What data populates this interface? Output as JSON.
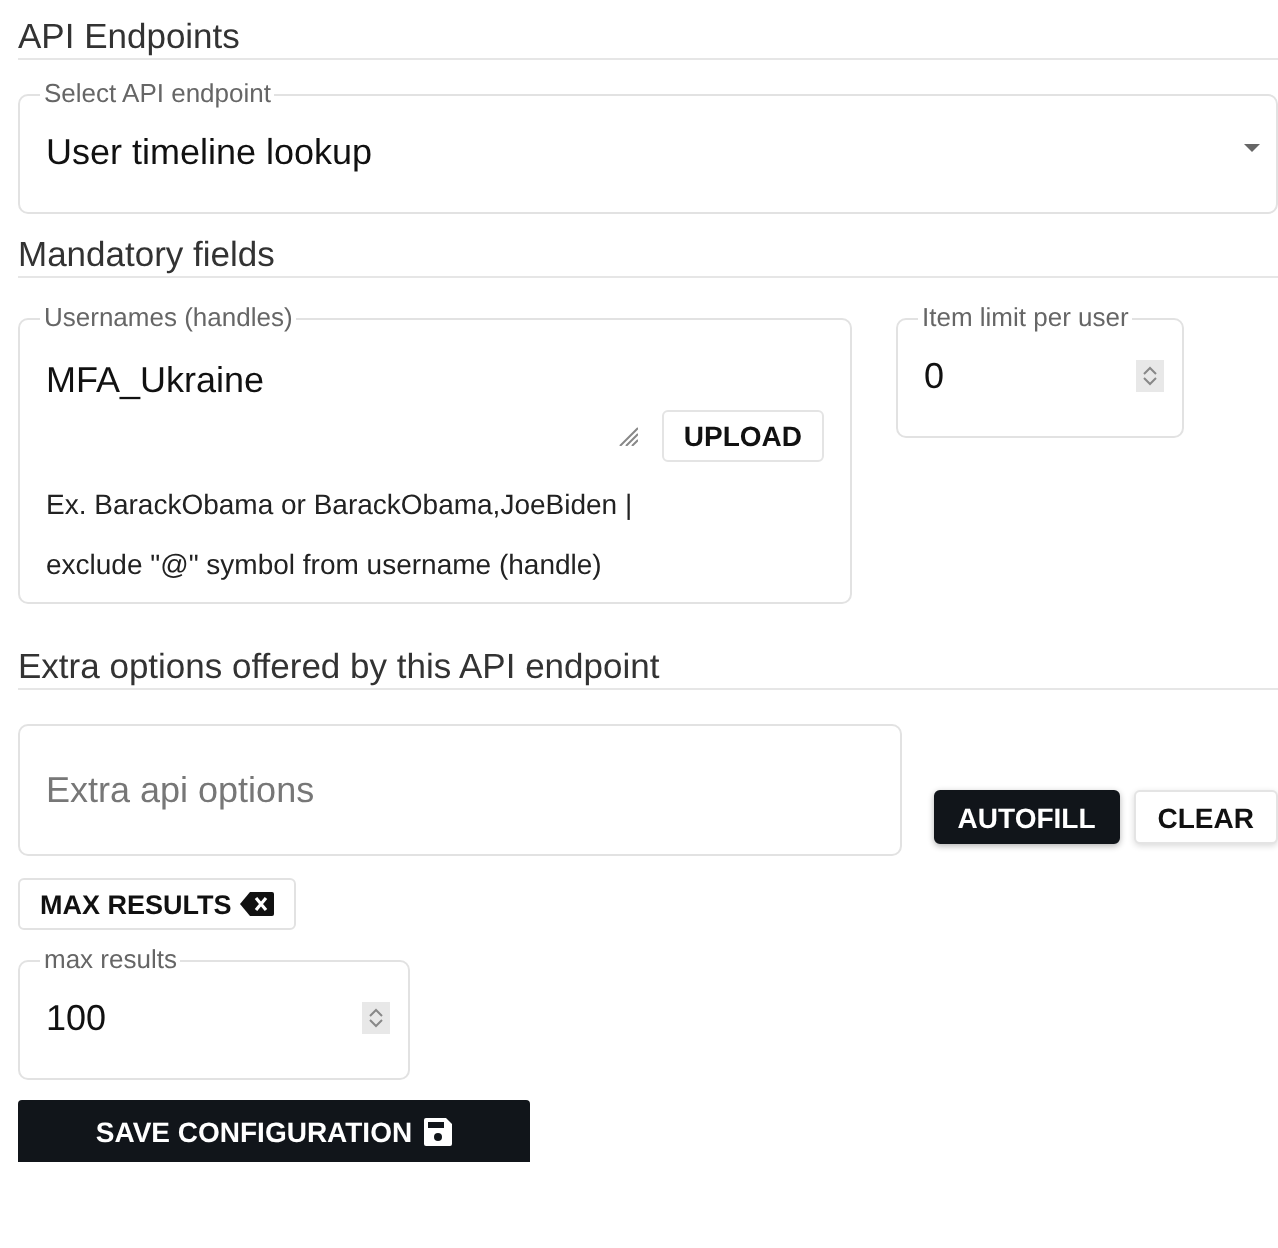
{
  "endpoint_section": {
    "title": "API Endpoints",
    "select": {
      "label": "Select API endpoint",
      "value": "User timeline lookup"
    }
  },
  "mandatory_section": {
    "title": "Mandatory fields",
    "usernames": {
      "label": "Usernames (handles)",
      "value": "MFA_Ukraine",
      "upload_button": "UPLOAD",
      "helper_lines": [
        "Ex. BarackObama or BarackObama,JoeBiden |",
        "exclude \"@\" symbol from username (handle)"
      ]
    },
    "item_limit": {
      "label": "Item limit per user",
      "value": "0"
    }
  },
  "extra_section": {
    "title": "Extra options offered by this API endpoint",
    "options_field": {
      "placeholder": "Extra api options"
    },
    "buttons": [
      {
        "label": "AUTOFILL",
        "kind": "primary"
      },
      {
        "label": "CLEAR",
        "kind": "secondary"
      }
    ],
    "chips": [
      {
        "label": "MAX RESULTS"
      }
    ],
    "max_results": {
      "label": "max results",
      "value": "100"
    }
  },
  "save_button": "SAVE CONFIGURATION"
}
